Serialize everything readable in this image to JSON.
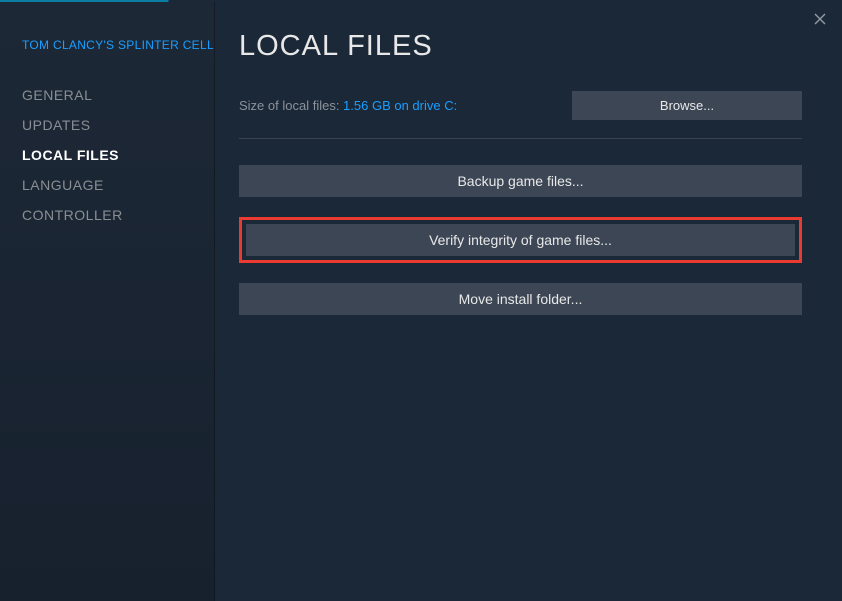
{
  "gameTitle": "TOM CLANCY'S SPLINTER CELL",
  "sidebar": {
    "items": [
      {
        "label": "GENERAL"
      },
      {
        "label": "UPDATES"
      },
      {
        "label": "LOCAL FILES"
      },
      {
        "label": "LANGUAGE"
      },
      {
        "label": "CONTROLLER"
      }
    ]
  },
  "main": {
    "title": "LOCAL FILES",
    "sizeLabel": "Size of local files: ",
    "sizeValue": "1.56 GB on drive C:",
    "browse": "Browse...",
    "backup": "Backup game files...",
    "verify": "Verify integrity of game files...",
    "move": "Move install folder..."
  }
}
